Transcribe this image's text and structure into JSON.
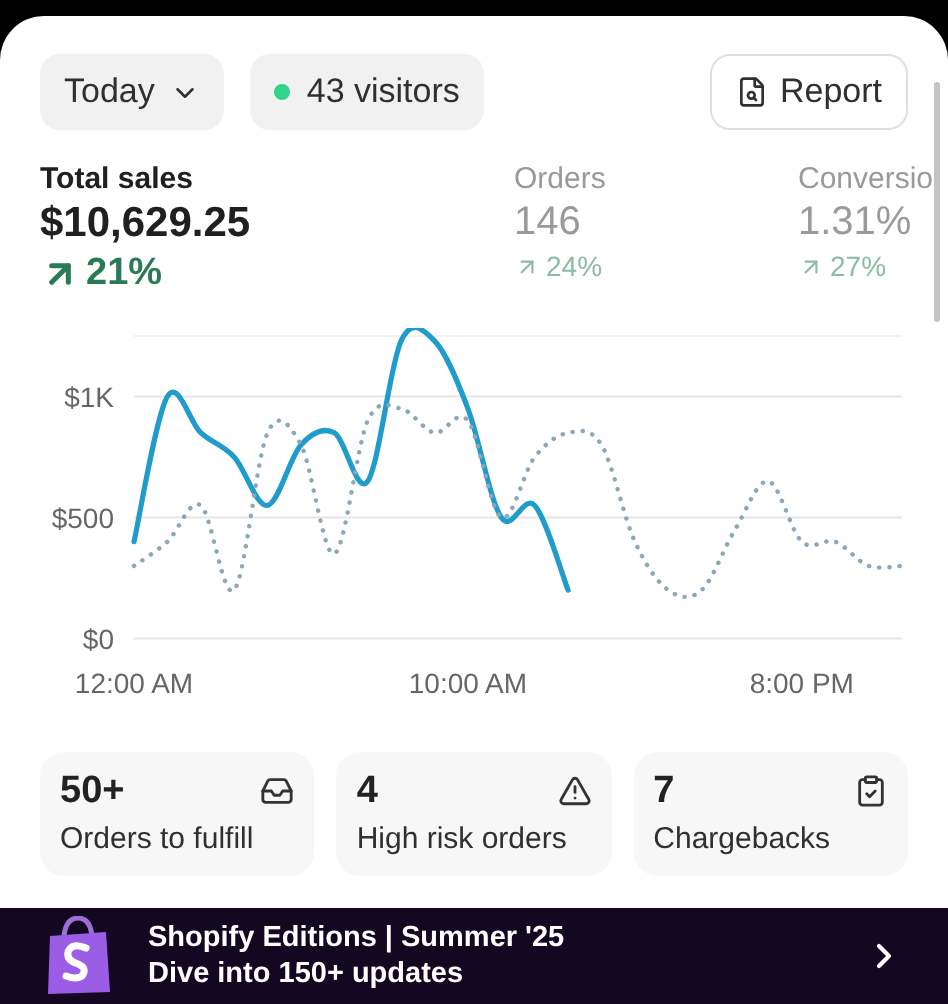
{
  "toolbar": {
    "date_range": "Today",
    "visitors": {
      "label": "43 visitors",
      "color": "#2fd58a"
    },
    "report_button": "Report"
  },
  "metrics": [
    {
      "label": "Total sales",
      "value": "$10,629.25",
      "change": "21%",
      "selected": true
    },
    {
      "label": "Orders",
      "value": "146",
      "change": "24%",
      "selected": false
    },
    {
      "label": "Conversio",
      "value": "1.31%",
      "change": "27%",
      "selected": false
    }
  ],
  "chart_data": {
    "type": "line",
    "x": [
      0,
      1,
      2,
      3,
      4,
      5,
      6,
      7,
      8,
      9,
      10,
      11,
      12,
      13,
      14,
      15,
      16,
      17,
      18,
      19,
      20,
      21,
      22,
      23
    ],
    "xlim": [
      0,
      23
    ],
    "ylim": [
      0,
      1250
    ],
    "xticks": [
      {
        "value": 0,
        "label": "12:00 AM"
      },
      {
        "value": 10,
        "label": "10:00 AM"
      },
      {
        "value": 20,
        "label": "8:00 PM"
      }
    ],
    "yticks": [
      {
        "value": 0,
        "label": "$0"
      },
      {
        "value": 500,
        "label": "$500"
      },
      {
        "value": 1000,
        "label": "$1K"
      }
    ],
    "series": [
      {
        "color": "#1f9ccb",
        "line_style": "solid",
        "values": [
          400,
          1000,
          850,
          750,
          550,
          800,
          850,
          650,
          1230,
          1230,
          950,
          500,
          550,
          200,
          null,
          null,
          null,
          null,
          null,
          null,
          null,
          null,
          null,
          null
        ]
      },
      {
        "color": "#8aa9b8",
        "line_style": "dotted",
        "values": [
          300,
          400,
          550,
          200,
          850,
          800,
          350,
          900,
          950,
          850,
          900,
          500,
          750,
          850,
          800,
          400,
          200,
          200,
          450,
          650,
          400,
          400,
          300,
          300
        ]
      }
    ]
  },
  "cards": [
    {
      "value": "50+",
      "label": "Orders to fulfill",
      "kind": "inbox"
    },
    {
      "value": "4",
      "label": "High risk orders",
      "kind": "warning"
    },
    {
      "value": "7",
      "label": "Chargebacks",
      "kind": "clipboard"
    }
  ],
  "banner": {
    "title": "Shopify Editions | Summer '25",
    "subtitle": "Dive into 150+ updates"
  }
}
